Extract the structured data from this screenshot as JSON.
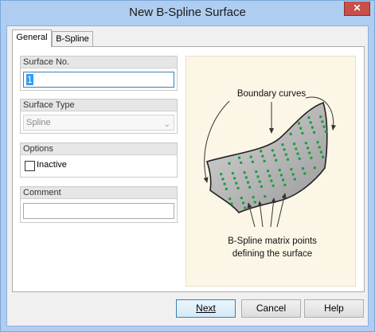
{
  "window": {
    "title": "New B-Spline Surface",
    "close_glyph": "✕"
  },
  "tabs": [
    {
      "label": "General",
      "active": true
    },
    {
      "label": "B-Spline",
      "active": false
    }
  ],
  "groups": {
    "surface_no": {
      "label": "Surface No.",
      "value": "1"
    },
    "surface_type": {
      "label": "Surface Type",
      "value": "Spline"
    },
    "options": {
      "label": "Options",
      "inactive_label": "Inactive",
      "inactive_checked": false
    },
    "comment": {
      "label": "Comment",
      "value": ""
    }
  },
  "figure": {
    "boundary_label": "Boundary curves",
    "matrix_label_line1": "B-Spline matrix points",
    "matrix_label_line2": "defining the surface",
    "surface_color": "#b3b3b3",
    "point_color": "#1a9b3c"
  },
  "buttons": {
    "next": "Next",
    "cancel": "Cancel",
    "help": "Help"
  },
  "colors": {
    "window_frame": "#aecdf0",
    "focus_border": "#3c7fb1"
  },
  "icons": {
    "close": "close-icon",
    "dropdown": "chevron-down-icon"
  }
}
